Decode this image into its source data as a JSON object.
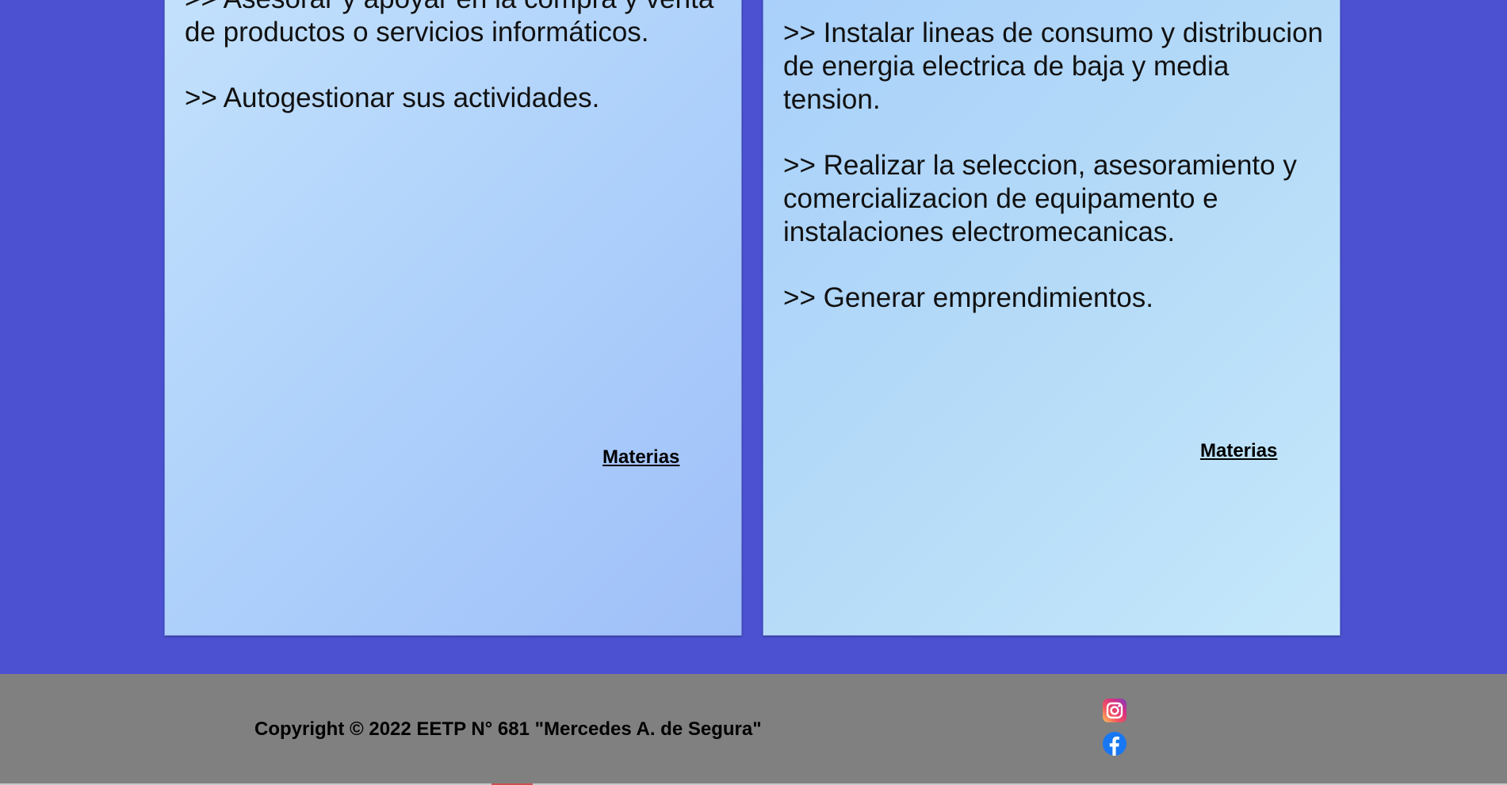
{
  "cards": [
    {
      "paragraphs": [
        ">> Asesorar y apoyar en la compra y venta de productos o servicios informáticos.",
        ">> Autogestionar sus actividades."
      ],
      "link_label": "Materias"
    },
    {
      "paragraphs": [
        ">> Instalar lineas de consumo y distribucion de energia electrica de baja y media tension.",
        ">> Realizar la seleccion, asesoramiento y comercializacion de equipamento e instalaciones electromecanicas.",
        ">> Generar emprendimientos."
      ],
      "link_label": "Materias"
    }
  ],
  "footer": {
    "copyright": "Copyright © 2022 EETP N° 681 \"Mercedes A. de Segura\"",
    "social": [
      {
        "icon": "instagram-icon"
      },
      {
        "icon": "facebook-icon"
      }
    ]
  },
  "colors": {
    "page_background": "#4b51d1",
    "footer_background": "#808080"
  }
}
